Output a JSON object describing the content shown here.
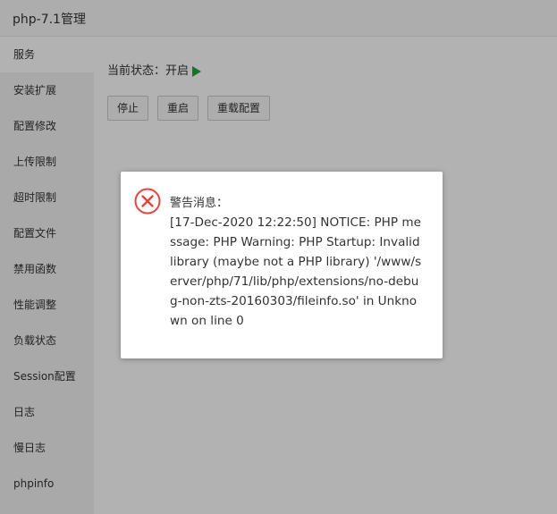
{
  "window": {
    "title": "php-7.1管理"
  },
  "sidebar": {
    "items": [
      {
        "label": "服务"
      },
      {
        "label": "安装扩展"
      },
      {
        "label": "配置修改"
      },
      {
        "label": "上传限制"
      },
      {
        "label": "超时限制"
      },
      {
        "label": "配置文件"
      },
      {
        "label": "禁用函数"
      },
      {
        "label": "性能调整"
      },
      {
        "label": "负载状态"
      },
      {
        "label": "Session配置"
      },
      {
        "label": "日志"
      },
      {
        "label": "慢日志"
      },
      {
        "label": "phpinfo"
      }
    ]
  },
  "main": {
    "status_label": "当前状态：",
    "status_value": "开启",
    "buttons": {
      "stop": "停止",
      "restart": "重启",
      "reload": "重载配置"
    }
  },
  "dialog": {
    "title": "警告消息：",
    "message": "[17-Dec-2020 12:22:50] NOTICE: PHP message: PHP Warning: PHP Startup: Invalid library (maybe not a PHP library) '/www/server/php/71/lib/php/extensions/no-debug-non-zts-20160303/fileinfo.so' in Unknown on line 0",
    "icon": "error-circle-icon"
  },
  "colors": {
    "accent_green": "#20a53a",
    "error_red": "#e9423c"
  }
}
